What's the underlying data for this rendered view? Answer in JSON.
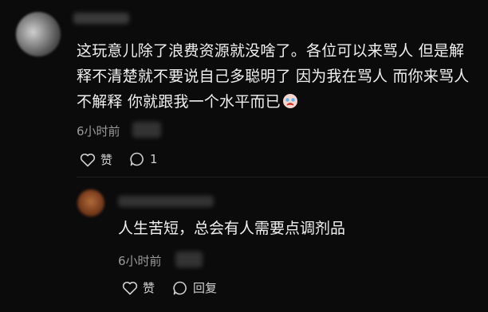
{
  "main_comment": {
    "text": "这玩意儿除了浪费资源就没啥了。各位可以来骂人 但是解释不清楚就不要说自己多聪明了 因为我在骂人 而你来骂人不解释 你就跟我一个水平而已",
    "emoji_icon": "crying-face-icon",
    "time": "6小时前",
    "like_label": "赞",
    "comment_count": "1"
  },
  "reply": {
    "text": "人生苦短，总会有人需要点调剂品",
    "time": "6小时前",
    "like_label": "赞",
    "reply_label": "回复"
  }
}
